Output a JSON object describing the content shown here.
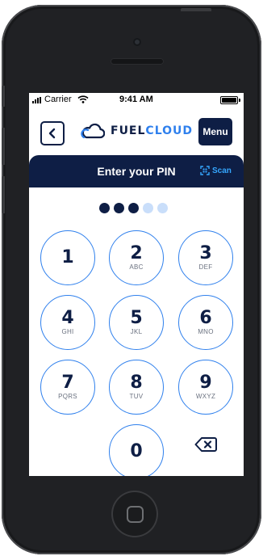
{
  "status_bar": {
    "carrier": "Carrier",
    "time": "9:41 AM"
  },
  "header": {
    "brand_part1": "FUEL",
    "brand_part2": "CLOUD",
    "menu_label": "Menu"
  },
  "pin": {
    "title": "Enter your PIN",
    "scan_label": "Scan",
    "digits_total": 5,
    "digits_entered": 3
  },
  "keypad": [
    {
      "num": "1",
      "letters": ""
    },
    {
      "num": "2",
      "letters": "ABC"
    },
    {
      "num": "3",
      "letters": "DEF"
    },
    {
      "num": "4",
      "letters": "GHI"
    },
    {
      "num": "5",
      "letters": "JKL"
    },
    {
      "num": "6",
      "letters": "MNO"
    },
    {
      "num": "7",
      "letters": "PQRS"
    },
    {
      "num": "8",
      "letters": "TUV"
    },
    {
      "num": "9",
      "letters": "WXYZ"
    },
    {
      "num": "0",
      "letters": ""
    }
  ],
  "colors": {
    "navy": "#0e1e45",
    "accent_blue": "#2f80ed",
    "scan_blue": "#35a7ff",
    "dot_empty": "#c9defa"
  },
  "icons": {
    "back": "chevron-left-icon",
    "logo": "cloud-icon",
    "scan": "qr-scan-icon",
    "delete": "backspace-icon"
  }
}
